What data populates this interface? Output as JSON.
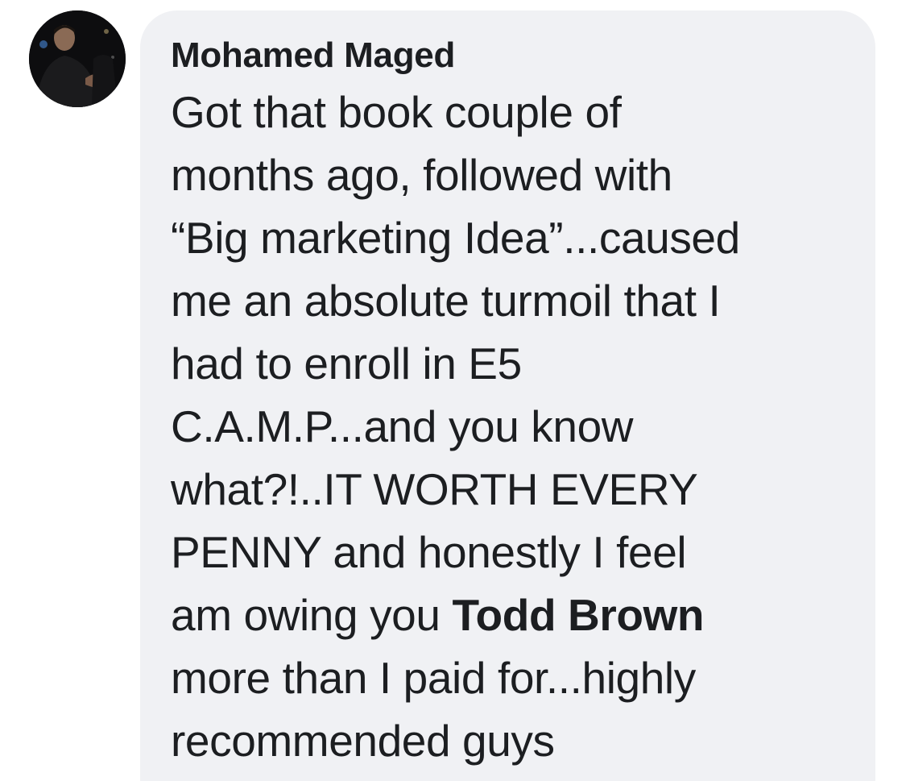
{
  "comment": {
    "author": "Mohamed Maged",
    "avatar_icon": "profile-photo",
    "lines": [
      "Got that book couple of",
      "months ago, followed with",
      "“Big marketing Idea”...caused",
      "me an absolute turmoil that I",
      "had to enroll in E5",
      "C.A.M.P...and you know",
      "what?!..IT WORTH EVERY",
      "PENNY and honestly I feel"
    ],
    "line9_before": "am owing you ",
    "mention": "Todd Brown",
    "lines_after": [
      "more than I paid for...highly",
      "recommended guys"
    ]
  },
  "colors": {
    "bubble": "#f0f1f4",
    "text": "#1c1e21"
  }
}
